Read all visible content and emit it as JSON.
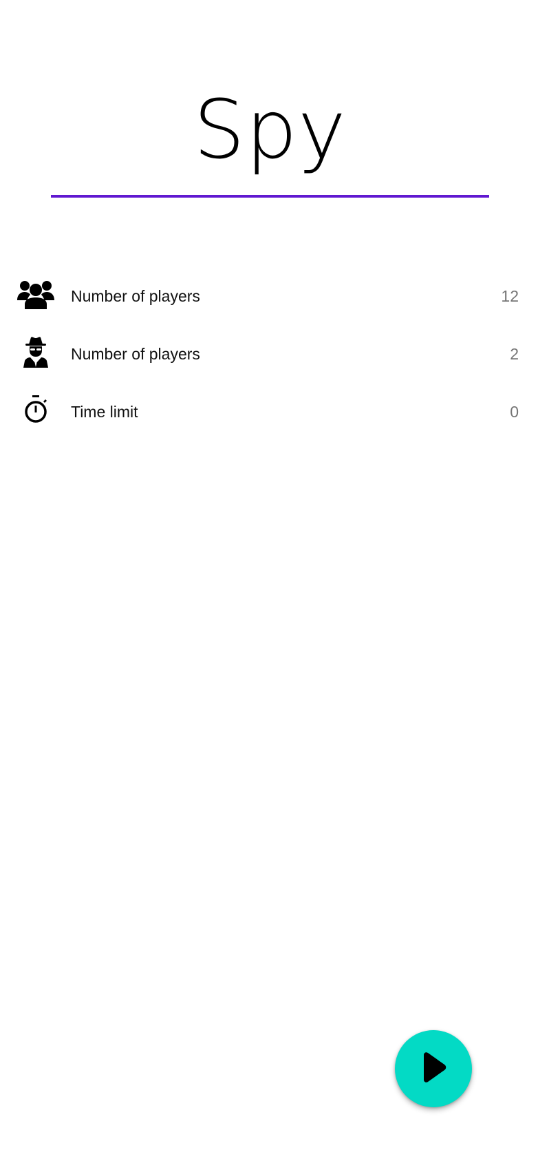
{
  "app": {
    "title": "Spy"
  },
  "colors": {
    "accent": "#6018d0",
    "fab": "#03dac5",
    "value_text": "#757575"
  },
  "settings": {
    "items": [
      {
        "icon": "group-icon",
        "label": "Number of players",
        "value": "12"
      },
      {
        "icon": "spy-icon",
        "label": "Number of players",
        "value": "2"
      },
      {
        "icon": "timer-icon",
        "label": "Time limit",
        "value": "0"
      }
    ]
  },
  "fab": {
    "icon": "play-icon"
  }
}
